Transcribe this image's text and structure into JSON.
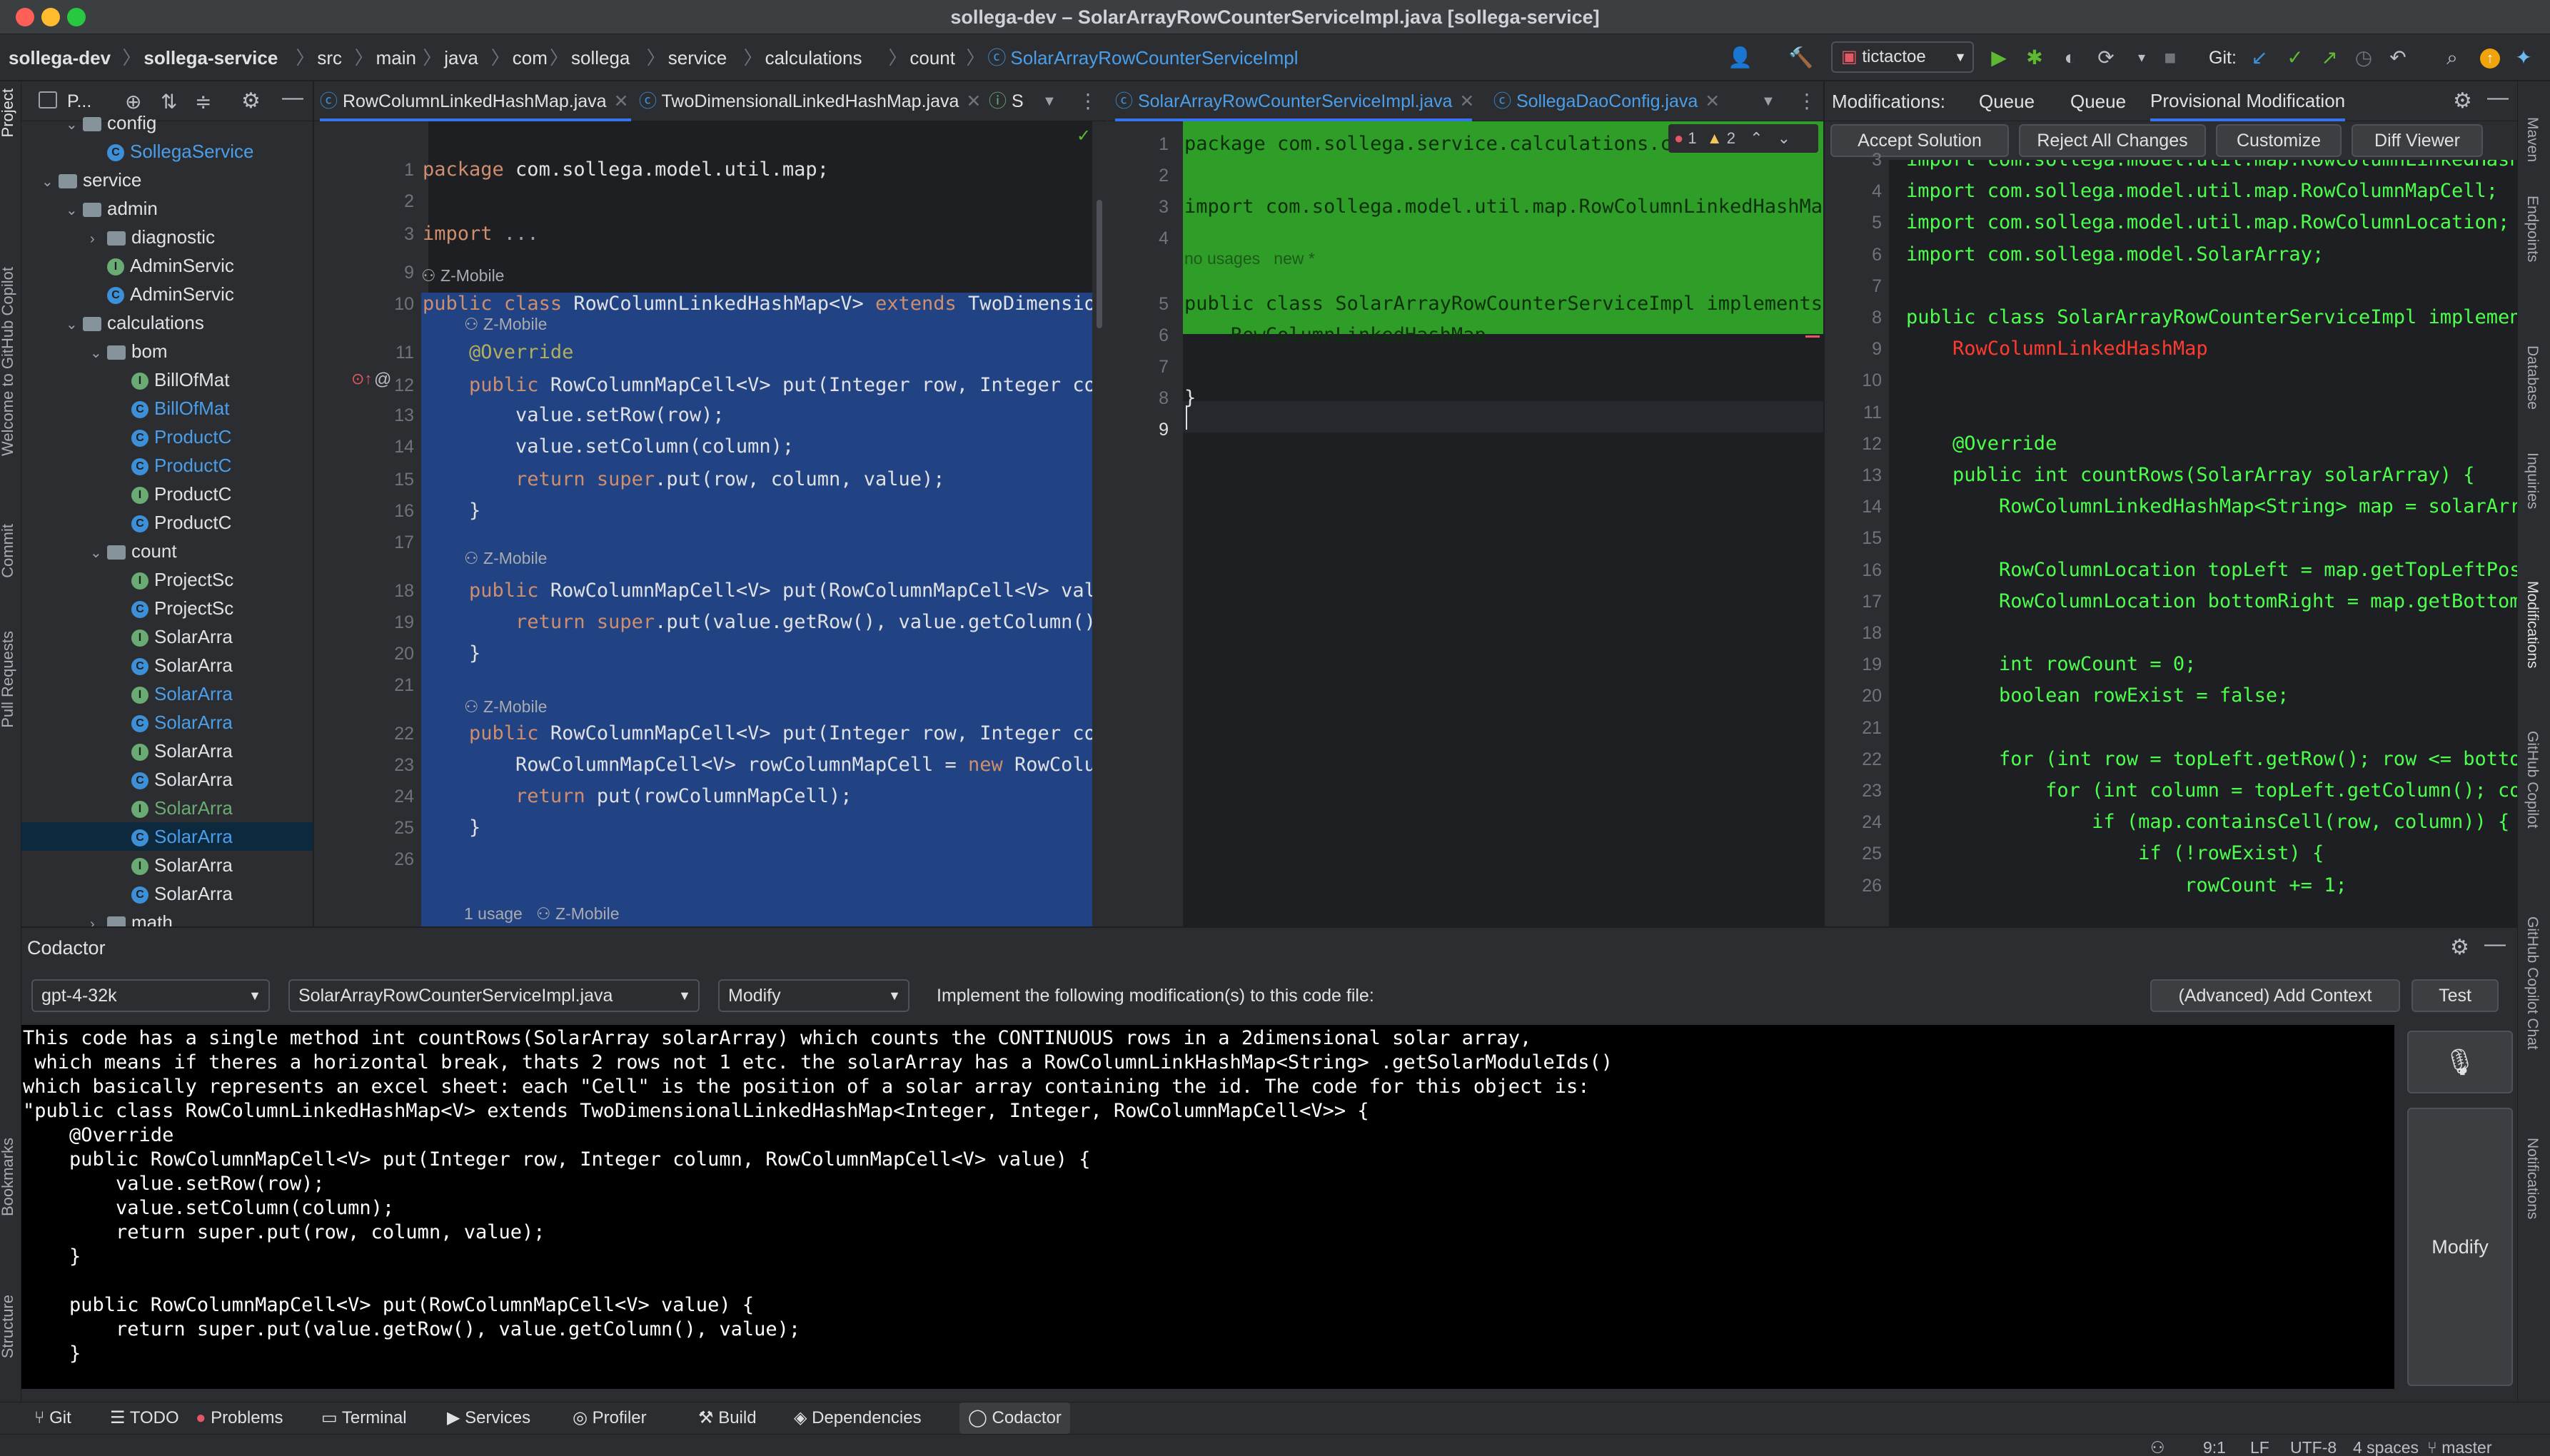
{
  "window": {
    "title": "sollega-dev – SolarArrayRowCounterServiceImpl.java [sollega-service]"
  },
  "breadcrumbs": [
    "sollega-dev",
    "sollega-service",
    "src",
    "main",
    "java",
    "com",
    "sollega",
    "service",
    "calculations",
    "count",
    "SolarArrayRowCounterServiceImpl"
  ],
  "toolbar": {
    "run_config": "tictactoe",
    "git_label": "Git:"
  },
  "project_panel": {
    "header": "P...",
    "tree": [
      {
        "label": "config",
        "type": "folder",
        "depth": 3,
        "expanded": true
      },
      {
        "label": "SollegaService",
        "type": "class",
        "depth": 4,
        "color": "#3d8fd8",
        "text_color": "#4a9eea"
      },
      {
        "label": "service",
        "type": "folder",
        "depth": 2,
        "expanded": true
      },
      {
        "label": "admin",
        "type": "folder",
        "depth": 3,
        "expanded": true
      },
      {
        "label": "diagnostic",
        "type": "folder",
        "depth": 4,
        "expanded": false
      },
      {
        "label": "AdminServic",
        "type": "interface",
        "depth": 4,
        "color": "#6aab73",
        "text_color": "#dfe1e5"
      },
      {
        "label": "AdminServic",
        "type": "class",
        "depth": 4,
        "color": "#3d8fd8",
        "text_color": "#dfe1e5"
      },
      {
        "label": "calculations",
        "type": "folder",
        "depth": 3,
        "expanded": true
      },
      {
        "label": "bom",
        "type": "folder",
        "depth": 4,
        "expanded": true
      },
      {
        "label": "BillOfMat",
        "type": "interface",
        "depth": 5,
        "color": "#6aab73",
        "text_color": "#dfe1e5"
      },
      {
        "label": "BillOfMat",
        "type": "class",
        "depth": 5,
        "color": "#3d8fd8",
        "text_color": "#4a9eea"
      },
      {
        "label": "ProductC",
        "type": "class",
        "depth": 5,
        "color": "#3d8fd8",
        "text_color": "#4a9eea"
      },
      {
        "label": "ProductC",
        "type": "class",
        "depth": 5,
        "color": "#3d8fd8",
        "text_color": "#4a9eea"
      },
      {
        "label": "ProductC",
        "type": "interface",
        "depth": 5,
        "color": "#6aab73",
        "text_color": "#dfe1e5"
      },
      {
        "label": "ProductC",
        "type": "class",
        "depth": 5,
        "color": "#3d8fd8",
        "text_color": "#dfe1e5"
      },
      {
        "label": "count",
        "type": "folder",
        "depth": 4,
        "expanded": true
      },
      {
        "label": "ProjectSc",
        "type": "interface",
        "depth": 5,
        "color": "#6aab73",
        "text_color": "#dfe1e5"
      },
      {
        "label": "ProjectSc",
        "type": "class",
        "depth": 5,
        "color": "#3d8fd8",
        "text_color": "#dfe1e5"
      },
      {
        "label": "SolarArra",
        "type": "interface",
        "depth": 5,
        "color": "#6aab73",
        "text_color": "#dfe1e5"
      },
      {
        "label": "SolarArra",
        "type": "class",
        "depth": 5,
        "color": "#3d8fd8",
        "text_color": "#dfe1e5"
      },
      {
        "label": "SolarArra",
        "type": "interface",
        "depth": 5,
        "color": "#6aab73",
        "text_color": "#4a9eea"
      },
      {
        "label": "SolarArra",
        "type": "class",
        "depth": 5,
        "color": "#3d8fd8",
        "text_color": "#4a9eea"
      },
      {
        "label": "SolarArra",
        "type": "interface",
        "depth": 5,
        "color": "#6aab73",
        "text_color": "#dfe1e5"
      },
      {
        "label": "SolarArra",
        "type": "class",
        "depth": 5,
        "color": "#3d8fd8",
        "text_color": "#dfe1e5"
      },
      {
        "label": "SolarArra",
        "type": "interface",
        "depth": 5,
        "color": "#6aab73",
        "text_color": "#6aab73"
      },
      {
        "label": "SolarArra",
        "type": "class",
        "depth": 5,
        "color": "#3d8fd8",
        "text_color": "#4a9eea",
        "selected": true
      },
      {
        "label": "SolarArra",
        "type": "interface",
        "depth": 5,
        "color": "#6aab73",
        "text_color": "#dfe1e5"
      },
      {
        "label": "SolarArra",
        "type": "class",
        "depth": 5,
        "color": "#3d8fd8",
        "text_color": "#dfe1e5"
      },
      {
        "label": "math",
        "type": "folder",
        "depth": 4,
        "expanded": false
      }
    ]
  },
  "editor1": {
    "tabs": [
      "RowColumnLinkedHashMap.java",
      "TwoDimensionalLinkedHashMap.java",
      "S"
    ],
    "lines": [
      {
        "n": "1",
        "text": "package com.sollega.model.util.map;"
      },
      {
        "n": "2",
        "text": ""
      },
      {
        "n": "3",
        "text": "import ..."
      },
      {
        "n": "9",
        "text": ""
      },
      {
        "n": "10",
        "text": "public class RowColumnLinkedHashMap<V> extends TwoDimensionalL"
      },
      {
        "n": "11",
        "text": "    @Override"
      },
      {
        "n": "12",
        "text": "    public RowColumnMapCell<V> put(Integer row, Integer column"
      },
      {
        "n": "13",
        "text": "        value.setRow(row);"
      },
      {
        "n": "14",
        "text": "        value.setColumn(column);"
      },
      {
        "n": "15",
        "text": "        return super.put(row, column, value);"
      },
      {
        "n": "16",
        "text": "    }"
      },
      {
        "n": "17",
        "text": ""
      },
      {
        "n": "18",
        "text": "    public RowColumnMapCell<V> put(RowColumnMapCell<V> value)"
      },
      {
        "n": "19",
        "text": "        return super.put(value.getRow(), value.getColumn(), va"
      },
      {
        "n": "20",
        "text": "    }"
      },
      {
        "n": "21",
        "text": ""
      },
      {
        "n": "22",
        "text": "    public RowColumnMapCell<V> put(Integer row, Integer column"
      },
      {
        "n": "23",
        "text": "        RowColumnMapCell<V> rowColumnMapCell = new RowColumnMa"
      },
      {
        "n": "24",
        "text": "        return put(rowColumnMapCell);"
      },
      {
        "n": "25",
        "text": "    }"
      },
      {
        "n": "26",
        "text": ""
      }
    ],
    "hints": {
      "author": "Z-Mobile",
      "usage": "1 usage"
    }
  },
  "editor2": {
    "tabs": [
      "SolarArrayRowCounterServiceImpl.java",
      "SollegaDaoConfig.java"
    ],
    "inspection": {
      "errors": "1",
      "warnings": "2"
    },
    "lines": [
      {
        "n": "1",
        "text": "package com.sollega.service.calculations.co"
      },
      {
        "n": "2",
        "text": ""
      },
      {
        "n": "3",
        "text": "import com.sollega.model.util.map.RowColumnLinkedHashMap;"
      },
      {
        "n": "4",
        "text": ""
      },
      {
        "n": "5",
        "text": "public class SolarArrayRowCounterServiceImpl implements S"
      },
      {
        "n": "6",
        "text": "    RowColumnLinkedHashMap"
      },
      {
        "n": "7",
        "text": ""
      },
      {
        "n": "8",
        "text": "}"
      },
      {
        "n": "9",
        "text": ""
      }
    ],
    "hint": "no usages   new *"
  },
  "modifications": {
    "header": "Modifications:",
    "tabs": [
      "Queue",
      "Queue",
      "Provisional Modification"
    ],
    "buttons": [
      "Accept Solution",
      "Reject All Changes",
      "Customize",
      "Diff Viewer"
    ],
    "lines": [
      {
        "n": "3",
        "text": "import com.sollega.model.util.map.RowColumnLinkedHashMa"
      },
      {
        "n": "4",
        "text": "import com.sollega.model.util.map.RowColumnMapCell;"
      },
      {
        "n": "5",
        "text": "import com.sollega.model.util.map.RowColumnLocation;"
      },
      {
        "n": "6",
        "text": "import com.sollega.model.SolarArray;"
      },
      {
        "n": "7",
        "text": ""
      },
      {
        "n": "8",
        "text": "public class SolarArrayRowCounterServiceImpl implements"
      },
      {
        "n": "9",
        "text": "    RowColumnLinkedHashMap",
        "red": true
      },
      {
        "n": "10",
        "text": ""
      },
      {
        "n": "11",
        "text": ""
      },
      {
        "n": "12",
        "text": "    @Override"
      },
      {
        "n": "13",
        "text": "    public int countRows(SolarArray solarArray) {"
      },
      {
        "n": "14",
        "text": "        RowColumnLinkedHashMap<String> map = solarArray"
      },
      {
        "n": "15",
        "text": ""
      },
      {
        "n": "16",
        "text": "        RowColumnLocation topLeft = map.getTopLeftPosit"
      },
      {
        "n": "17",
        "text": "        RowColumnLocation bottomRight = map.getBottomRi"
      },
      {
        "n": "18",
        "text": ""
      },
      {
        "n": "19",
        "text": "        int rowCount = 0;"
      },
      {
        "n": "20",
        "text": "        boolean rowExist = false;"
      },
      {
        "n": "21",
        "text": ""
      },
      {
        "n": "22",
        "text": "        for (int row = topLeft.getRow(); row <= bottomR"
      },
      {
        "n": "23",
        "text": "            for (int column = topLeft.getColumn(); colu"
      },
      {
        "n": "24",
        "text": "                if (map.containsCell(row, column)) {"
      },
      {
        "n": "25",
        "text": "                    if (!rowExist) {"
      },
      {
        "n": "26",
        "text": "                        rowCount += 1;"
      }
    ]
  },
  "codactor": {
    "title": "Codactor",
    "model": "gpt-4-32k",
    "file": "SolarArrayRowCounterServiceImpl.java",
    "mode": "Modify",
    "instruction": "Implement the following modification(s) to this code file:",
    "add_context": "(Advanced) Add Context",
    "test": "Test",
    "modify": "Modify",
    "prompt_lines": [
      "This code has a single method int countRows(SolarArray solarArray) which counts the CONTINUOUS rows in a 2dimensional solar array,",
      " which means if theres a horizontal break, thats 2 rows not 1 etc. the solarArray has a RowColumnLinkHashMap<String> .getSolarModuleIds()",
      "which basically represents an excel sheet: each \"Cell\" is the position of a solar array containing the id. The code for this object is:",
      "\"public class RowColumnLinkedHashMap<V> extends TwoDimensionalLinkedHashMap<Integer, Integer, RowColumnMapCell<V>> {",
      "    @Override",
      "    public RowColumnMapCell<V> put(Integer row, Integer column, RowColumnMapCell<V> value) {",
      "        value.setRow(row);",
      "        value.setColumn(column);",
      "        return super.put(row, column, value);",
      "    }",
      "",
      "    public RowColumnMapCell<V> put(RowColumnMapCell<V> value) {",
      "        return super.put(value.getRow(), value.getColumn(), value);",
      "    }"
    ]
  },
  "tool_tabs": [
    "Git",
    "TODO",
    "Problems",
    "Terminal",
    "Services",
    "Profiler",
    "Build",
    "Dependencies",
    "Codactor"
  ],
  "left_strip": [
    "Project",
    "Welcome to GitHub Copilot",
    "Commit",
    "Pull Requests",
    "Bookmarks",
    "Structure"
  ],
  "right_strip": [
    "Maven",
    "Endpoints",
    "Database",
    "Inquiries",
    "Modifications",
    "GitHub Copilot",
    "GitHub Copilot Chat",
    "Notifications"
  ],
  "status": {
    "position": "9:1",
    "line_sep": "LF",
    "encoding": "UTF-8",
    "indent": "4 spaces",
    "branch": "master"
  },
  "colors": {
    "editor1_selection": "#214283",
    "editor2_added": "#2f9e28",
    "accent": "#3574f0",
    "green_text": "#4cff4c"
  }
}
